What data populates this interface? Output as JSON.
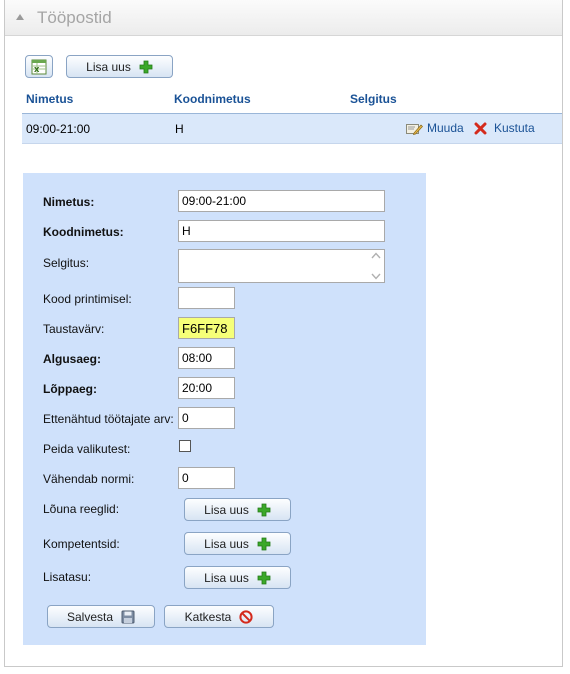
{
  "panel": {
    "title": "Tööpostid"
  },
  "toolbar": {
    "add_label": "Lisa uus"
  },
  "table": {
    "headers": [
      "Nimetus",
      "Koodnimetus",
      "Selgitus"
    ],
    "rows": [
      {
        "nimetus": "09:00-21:00",
        "kood": "H",
        "selgitus": "",
        "edit_label": "Muuda",
        "delete_label": "Kustuta"
      }
    ]
  },
  "form": {
    "nimetus": {
      "label": "Nimetus:",
      "value": "09:00-21:00"
    },
    "koodnimetus": {
      "label": "Koodnimetus:",
      "value": "H"
    },
    "selgitus": {
      "label": "Selgitus:",
      "value": ""
    },
    "kood_print": {
      "label": "Kood printimisel:",
      "value": ""
    },
    "taustavarv": {
      "label": "Taustavärv:",
      "value": "F6FF78",
      "color": "#F6FF78"
    },
    "algusaeg": {
      "label": "Algusaeg:",
      "value": "08:00"
    },
    "loppaeg": {
      "label": "Lõppaeg:",
      "value": "20:00"
    },
    "ettenahtud": {
      "label": "Ettenähtud töötajate arv:",
      "value": "0"
    },
    "peida": {
      "label": "Peida valikutest:",
      "checked": false
    },
    "vahendab": {
      "label": "Vähendab normi:",
      "value": "0"
    },
    "louna": {
      "label": "Lõuna reeglid:",
      "button": "Lisa uus"
    },
    "kompetentsid": {
      "label": "Kompetentsid:",
      "button": "Lisa uus"
    },
    "lisatasu": {
      "label": "Lisatasu:",
      "button": "Lisa uus"
    },
    "save_label": "Salvesta",
    "cancel_label": "Katkesta"
  }
}
